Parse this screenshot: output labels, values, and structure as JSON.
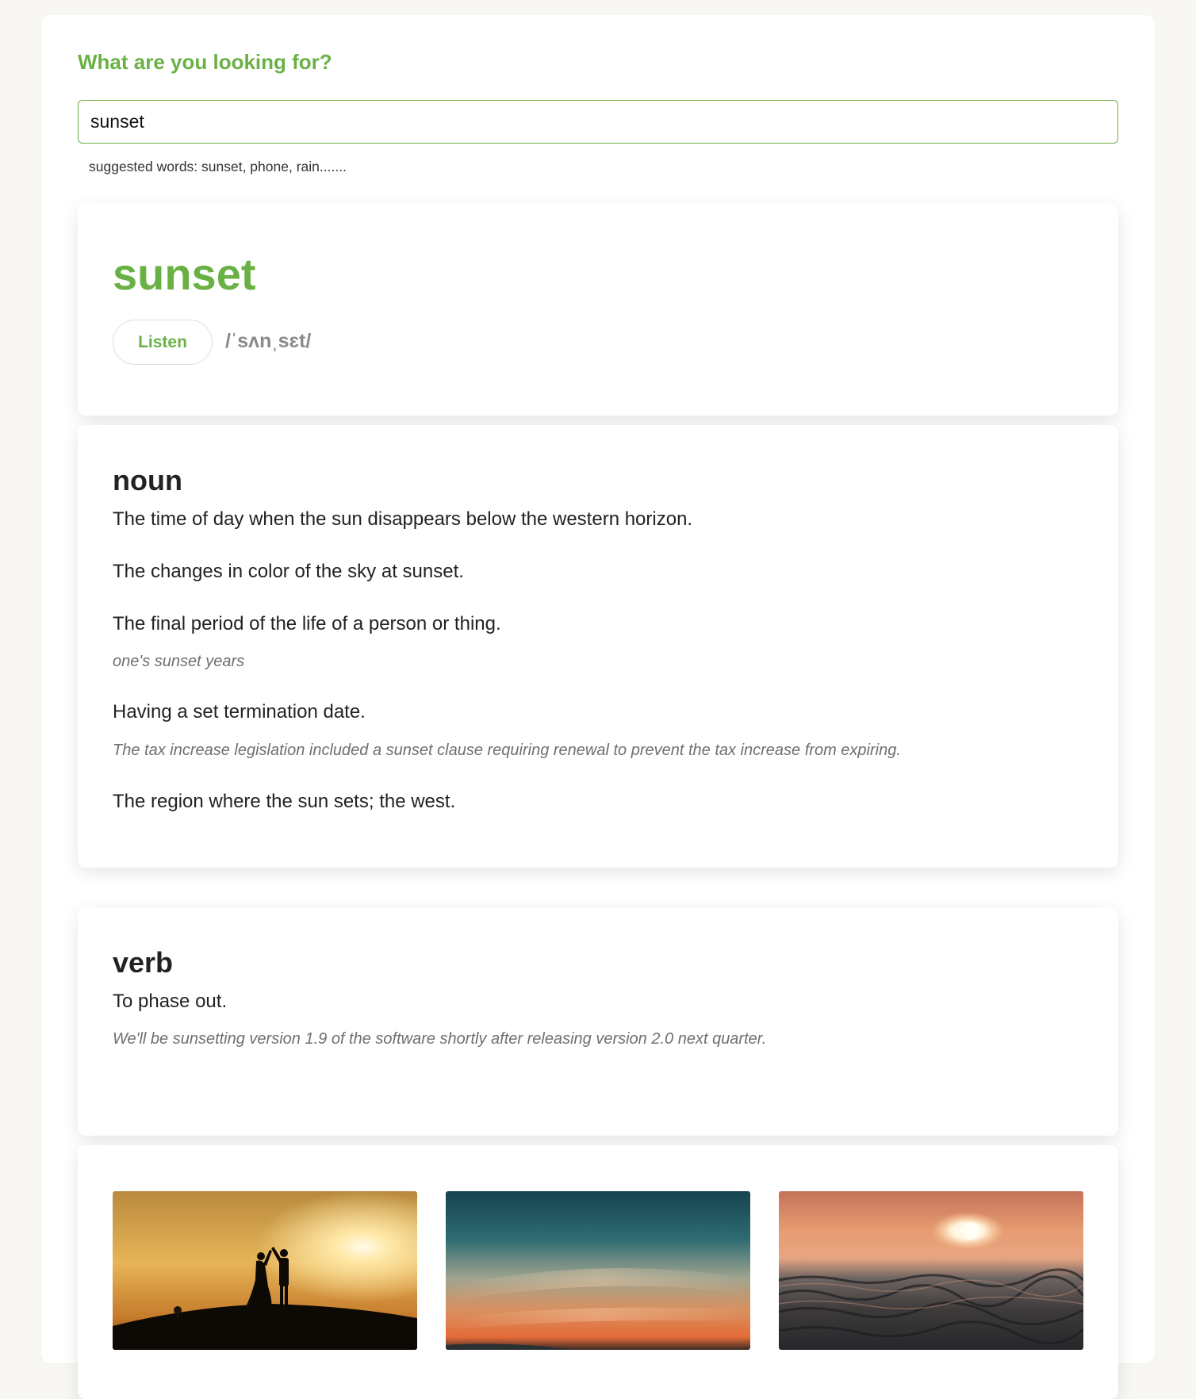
{
  "search": {
    "heading": "What are you looking for?",
    "value": "sunset",
    "hint": "suggested words: sunset, phone, rain......."
  },
  "word": {
    "title": "sunset",
    "listen_label": "Listen",
    "phonetic": "/ˈsʌnˌsɛt/"
  },
  "noun": {
    "pos": "noun",
    "definitions": [
      {
        "text": "The time of day when the sun disappears below the western horizon."
      },
      {
        "text": "The changes in color of the sky at sunset."
      },
      {
        "text": "The final period of the life of a person or thing.",
        "example": "one's sunset years"
      },
      {
        "text": "Having a set termination date.",
        "example": "The tax increase legislation included a sunset clause requiring renewal to prevent the tax increase from expiring."
      },
      {
        "text": "The region where the sun sets; the west."
      }
    ]
  },
  "verb": {
    "pos": "verb",
    "definitions": [
      {
        "text": "To phase out.",
        "example": "We'll be sunsetting version 1.9 of the software shortly after releasing version 2.0 next quarter."
      }
    ]
  },
  "images": [
    {
      "subject": "couple silhouette on hill at sunset"
    },
    {
      "subject": "teal and orange sunset sky"
    },
    {
      "subject": "sun setting over ocean waves"
    }
  ],
  "colors": {
    "accent": "#6ab145",
    "background": "#f8f7f3",
    "muted": "#6f6f6f"
  }
}
